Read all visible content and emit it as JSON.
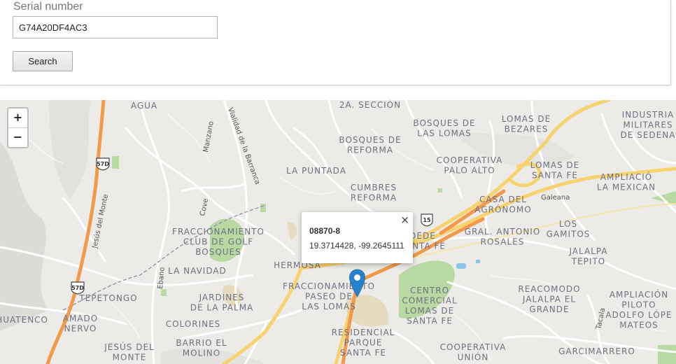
{
  "search": {
    "label": "Serial number",
    "value": "G74A20DF4AC3",
    "button_label": "Search"
  },
  "map": {
    "zoom_in_label": "+",
    "zoom_out_label": "−",
    "popup": {
      "close_label": "×",
      "title": "08870-8",
      "coordinates": "19.3714428, -99.2645111"
    },
    "shields": [
      "57D",
      "57D",
      "15"
    ],
    "street_labels": [
      "Vialidad de la Barranca",
      "Jesús del Monte",
      "Manzano",
      "Cove",
      "Ebano",
      "Galeana",
      "Tacala"
    ],
    "place_labels": [
      [
        "AGUA"
      ],
      [
        "2A. SECCIÓN"
      ],
      [
        "BOSQUES DE",
        "LAS LOMAS"
      ],
      [
        "LOMAS DE",
        "BEZARES"
      ],
      [
        "INDUSTRIA",
        "MILITARES",
        "DE SEDENA"
      ],
      [
        "BOSQUES DE",
        "REFORMA"
      ],
      [
        "COOPERATIVA",
        "PALO ALTO"
      ],
      [
        "LOMAS DE",
        "SANTA FE"
      ],
      [
        "AMPLIACIÓ",
        "LA MEXICAN"
      ],
      [
        "LA PUNTADA"
      ],
      [
        "CUMBRES",
        "REFORMA"
      ],
      [
        "CASA DEL",
        "AGRÓNOMO"
      ],
      [
        "FRACCIONAMIENTO",
        "CLUB DE GOLF",
        "BOSQUES"
      ],
      [
        "DEDE",
        "SANTA FE"
      ],
      [
        "GRAL. ANTONIO",
        "ROSALES"
      ],
      [
        "LOS",
        "GAMITOS"
      ],
      [
        "JALALPA",
        "TEPITO"
      ],
      [
        "LA NAVIDAD"
      ],
      [
        "HERMOSA"
      ],
      [
        "FRACCIONAMIENTO",
        "PASEO DE",
        "LAS LOMAS"
      ],
      [
        "CENTRO",
        "COMERCIAL",
        "LOMAS DE",
        "SANTA FE"
      ],
      [
        "REACOMODO",
        "JALALPA EL",
        "GRANDE"
      ],
      [
        "AMPLIACIÓN",
        "PILOTO",
        "ADOLFO LÓPE",
        "MATEOS"
      ],
      [
        "TEPETONGO"
      ],
      [
        "JARDINES",
        "DE LA PALMA"
      ],
      [
        "AHUATENCO"
      ],
      [
        "AMADO",
        "NERVO"
      ],
      [
        "COLORINES"
      ],
      [
        "RESIDENCIAL",
        "PARQUE",
        "SANTA FE"
      ],
      [
        "JESÚS DEL",
        "MONTE"
      ],
      [
        "BARRIO EL",
        "MOLINO"
      ],
      [
        "COOPERATIVA",
        "UNIÓN"
      ],
      [
        "GARCIMARRERO"
      ]
    ]
  },
  "colors": {
    "highway": "#f29a4a",
    "main_road": "#f7d370",
    "park": "#b9d9a3",
    "water": "#8bc2e8",
    "marker": "#2a81cb",
    "label": "#6d7180"
  }
}
